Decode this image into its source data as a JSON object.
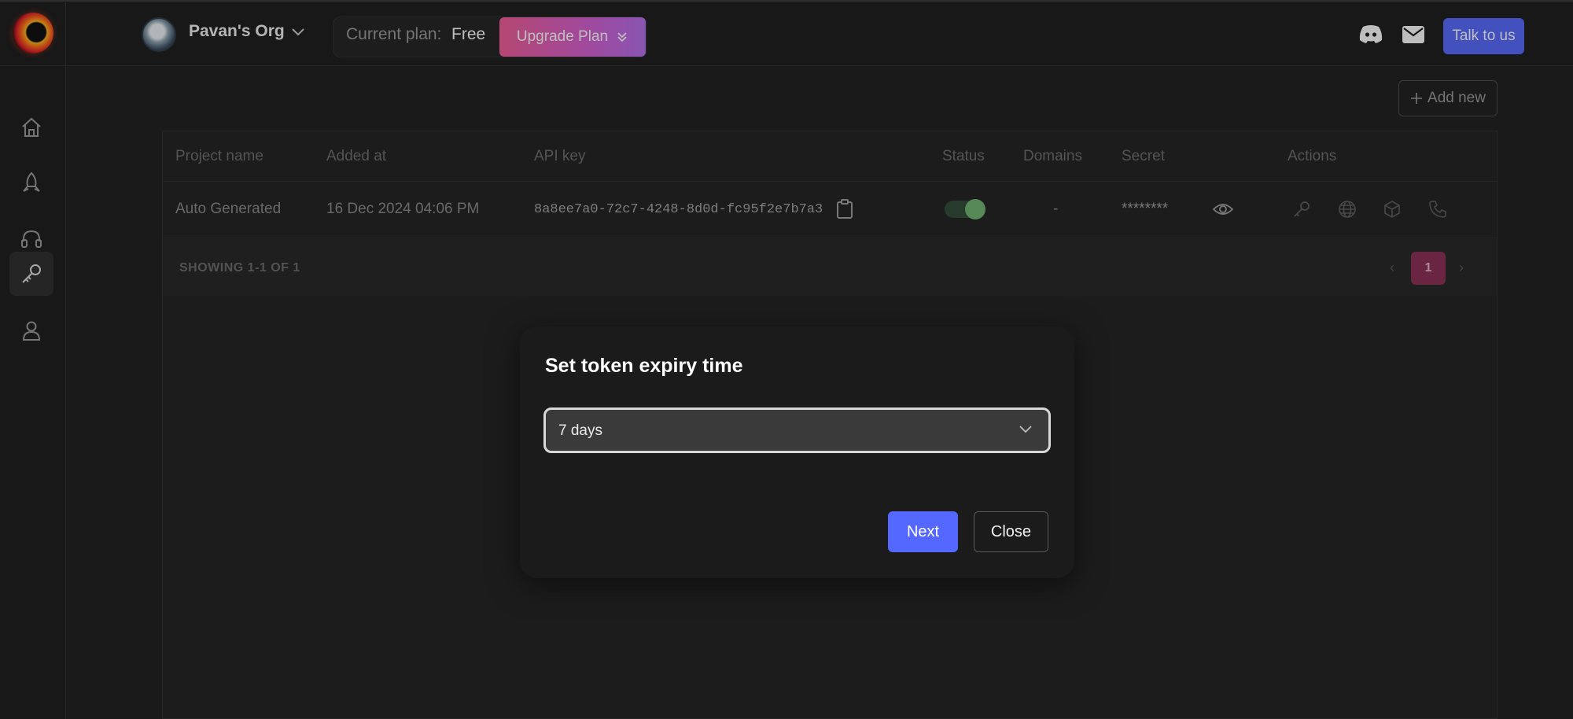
{
  "topbar": {
    "org_name": "Pavan's Org",
    "plan_label": "Current plan:",
    "plan_value": "Free",
    "upgrade_label": "Upgrade Plan",
    "talk_label": "Talk to us",
    "icons": [
      "app-logo",
      "discord-icon",
      "mail-icon"
    ]
  },
  "sidebar": {
    "items": [
      {
        "name": "home",
        "icon": "home-icon"
      },
      {
        "name": "launch",
        "icon": "rocket-icon"
      },
      {
        "name": "support",
        "icon": "headset-icon"
      },
      {
        "name": "api-keys",
        "icon": "key-icon",
        "active": true
      },
      {
        "name": "profile",
        "icon": "user-icon"
      }
    ]
  },
  "main": {
    "add_new_label": "Add new",
    "table": {
      "headers": [
        "Project name",
        "Added at",
        "API key",
        "Status",
        "Domains",
        "Secret",
        "Actions"
      ],
      "rows": [
        {
          "project_name": "Auto Generated",
          "added_at": "16 Dec 2024 04:06 PM",
          "api_key": "8a8ee7a0-72c7-4248-8d0d-fc95f2e7b7a3",
          "status_on": true,
          "domains": "-",
          "secret": "********"
        }
      ],
      "showing": "SHOWING 1-1 OF 1",
      "current_page": "1"
    }
  },
  "modal": {
    "title": "Set token expiry time",
    "selected_value": "7 days",
    "next_label": "Next",
    "close_label": "Close"
  },
  "colors": {
    "accent": "#5468ff",
    "page_active": "#8a2c52",
    "toggle_on": "#6fb572"
  }
}
